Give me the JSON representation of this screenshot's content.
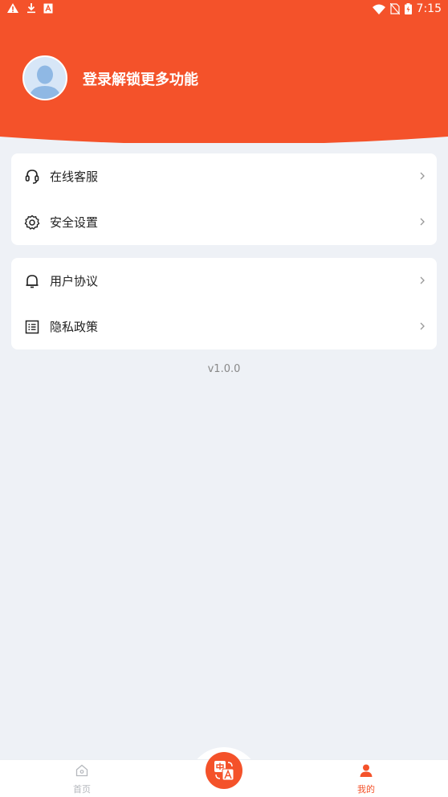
{
  "colors": {
    "accent": "#f4522a",
    "background": "#eef1f6",
    "card": "#ffffff",
    "text": "#222222",
    "muted": "#888888"
  },
  "status_bar": {
    "time": "7:15",
    "left_icons": [
      "warning-icon",
      "download-icon",
      "a-icon"
    ],
    "right_icons": [
      "wifi-icon",
      "no-sim-icon",
      "battery-icon"
    ]
  },
  "header": {
    "login_prompt": "登录解锁更多功能",
    "avatar_icon": "user-avatar-icon"
  },
  "menu_groups": [
    {
      "items": [
        {
          "label": "在线客服",
          "icon": "headset-icon"
        },
        {
          "label": "安全设置",
          "icon": "gear-icon"
        }
      ]
    },
    {
      "items": [
        {
          "label": "用户协议",
          "icon": "bell-icon"
        },
        {
          "label": "隐私政策",
          "icon": "list-icon"
        }
      ]
    }
  ],
  "version": "v1.0.0",
  "tabbar": {
    "home": {
      "label": "首页",
      "icon": "home-icon"
    },
    "center": {
      "icon": "translate-icon"
    },
    "mine": {
      "label": "我的",
      "icon": "person-icon"
    }
  }
}
